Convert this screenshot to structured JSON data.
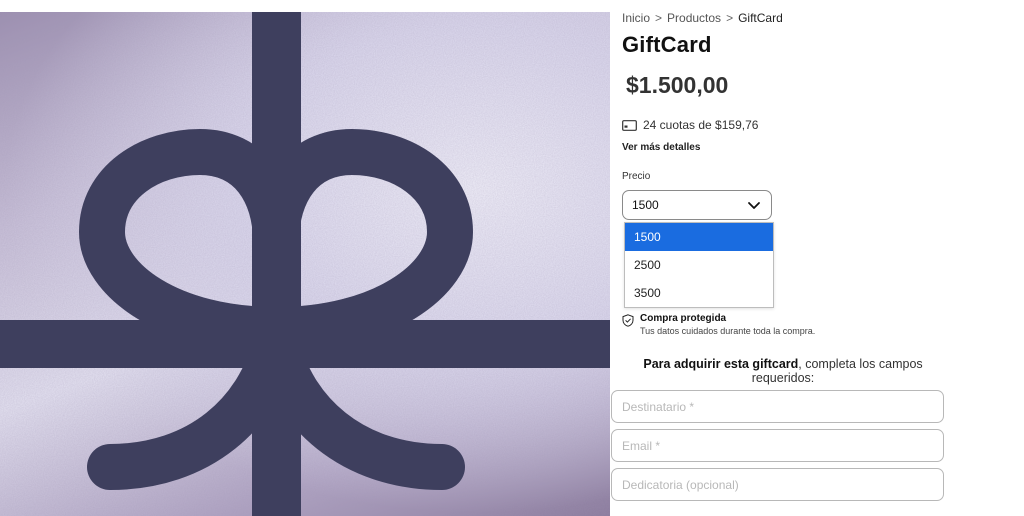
{
  "breadcrumb": {
    "home": "Inicio",
    "category": "Productos",
    "current": "GiftCard",
    "separator": ">"
  },
  "product": {
    "title": "GiftCard",
    "price": "$1.500,00",
    "installments_text": "24 cuotas de $159,76",
    "details_link": "Ver más detalles"
  },
  "price_select": {
    "label": "Precio",
    "selected": "1500",
    "options": [
      "1500",
      "2500",
      "3500"
    ]
  },
  "protection": {
    "title": "Compra protegida",
    "subtitle": "Tus datos cuidados durante toda la compra."
  },
  "instructions": {
    "bold": "Para adquirir esta giftcard",
    "rest": ", completa los campos requeridos:"
  },
  "form": {
    "recipient_placeholder": "Destinatario *",
    "email_placeholder": "Email *",
    "dedication_placeholder": "Dedicatoria (opcional)"
  },
  "colors": {
    "ribbon": "#3e3f5e",
    "select_highlight": "#1a6ce0"
  },
  "icons": {
    "installments": "credit-card-icon",
    "select": "chevron-down-icon",
    "protection": "shield-check-icon"
  }
}
